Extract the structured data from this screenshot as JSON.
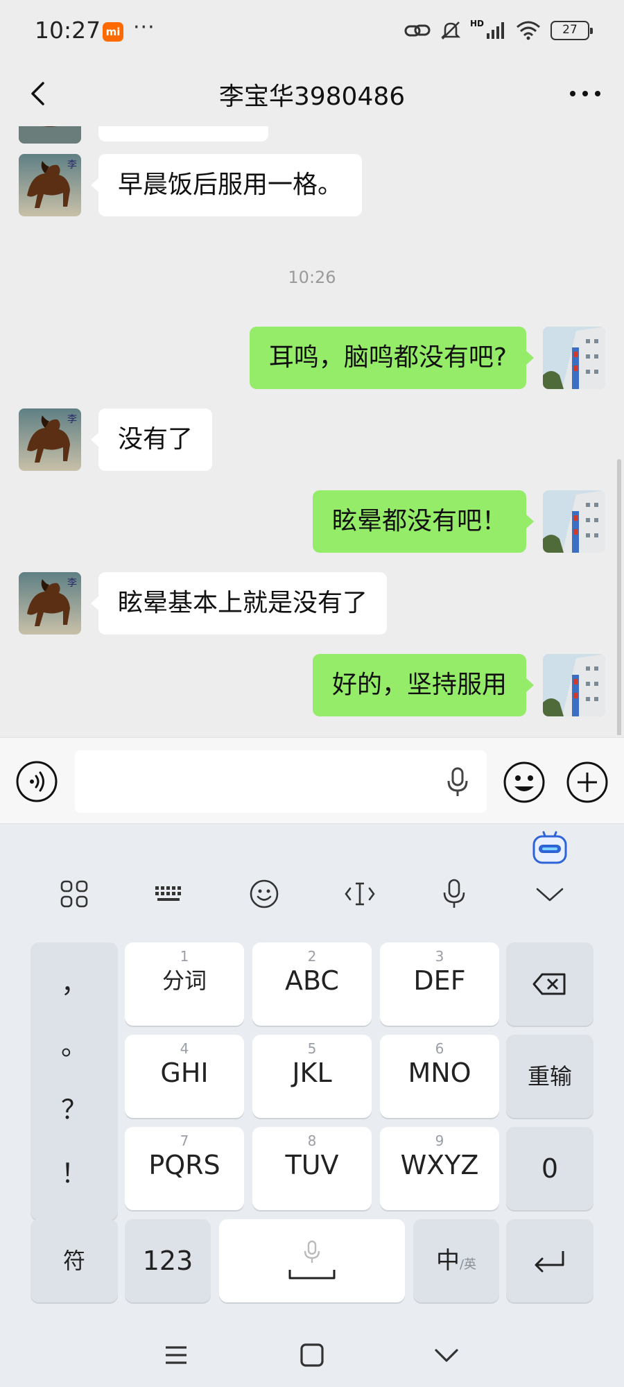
{
  "status_bar": {
    "time": "10:27",
    "brand_badge": "mi",
    "dots": "···",
    "hd": "HD",
    "battery": "27",
    "icons": [
      "link-icon",
      "bell-muted-icon",
      "signal-icon",
      "wifi-icon",
      "battery-icon"
    ]
  },
  "header": {
    "title": "李宝华3980486",
    "back_icon": "chevron-left-icon",
    "more_icon": "more-dots-icon"
  },
  "chat": {
    "messages": [
      {
        "side": "in",
        "text": "早晨饭后服用一格。"
      },
      {
        "side": "time",
        "text": "10:26"
      },
      {
        "side": "out",
        "text": "耳鸣，脑鸣都没有吧?"
      },
      {
        "side": "in",
        "text": "没有了"
      },
      {
        "side": "out",
        "text": "眩晕都没有吧！"
      },
      {
        "side": "in",
        "text": "眩晕基本上就是没有了"
      },
      {
        "side": "out",
        "text": "好的，坚持服用"
      }
    ]
  },
  "input_bar": {
    "value": "",
    "icons": [
      "voice-wave-icon",
      "microphone-icon",
      "emoji-icon",
      "plus-icon"
    ]
  },
  "keyboard": {
    "toolbar_icons": [
      "grid-icon",
      "keyboard-icon",
      "smile-icon",
      "cursor-icon",
      "microphone-icon",
      "chevron-down-icon"
    ],
    "punctuation": [
      "，",
      "。",
      "？",
      "！"
    ],
    "keys": [
      {
        "num": "1",
        "label": "分词"
      },
      {
        "num": "2",
        "label": "ABC"
      },
      {
        "num": "3",
        "label": "DEF"
      },
      {
        "num": "4",
        "label": "GHI"
      },
      {
        "num": "5",
        "label": "JKL"
      },
      {
        "num": "6",
        "label": "MNO"
      },
      {
        "num": "7",
        "label": "PQRS"
      },
      {
        "num": "8",
        "label": "TUV"
      },
      {
        "num": "9",
        "label": "WXYZ"
      }
    ],
    "right_keys": {
      "delete_icon": "backspace-icon",
      "reinput": "重输",
      "zero": "0",
      "enter_icon": "enter-icon"
    },
    "bottom": {
      "symbols": "符",
      "numbers": "123",
      "lang_main": "中",
      "lang_sub": "/英"
    }
  },
  "nav_bar": {
    "icons": [
      "menu-icon",
      "home-square-icon",
      "back-chevron-icon"
    ]
  },
  "colors": {
    "background": "#ededed",
    "outgoing": "#95ec69",
    "incoming": "#ffffff",
    "keyboard": "#e9ecf1"
  }
}
